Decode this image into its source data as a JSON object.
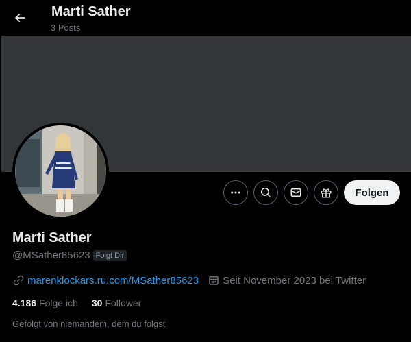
{
  "header": {
    "back_icon": "arrow-left-icon",
    "name": "Marti Sather",
    "posts": "3 Posts"
  },
  "profile": {
    "name": "Marti Sather",
    "handle": "@MSather85623",
    "follows_you_badge": "Folgt Dir",
    "link": "marenklockars.ru.com/MSather85623",
    "joined": "Seit November 2023 bei Twitter",
    "following_count": "4.186",
    "following_label": "Folge ich",
    "followers_count": "30",
    "followers_label": "Follower",
    "followed_by": "Gefolgt von niemandem, dem du folgst"
  },
  "actions": {
    "more_icon": "more-icon",
    "search_icon": "search-icon",
    "message_icon": "mail-icon",
    "gift_icon": "gift-icon",
    "follow_label": "Folgen"
  },
  "colors": {
    "background": "#000000",
    "banner": "#333639",
    "link": "#1d9bf0",
    "muted": "#71767b",
    "follow_button": "#eff3f4"
  }
}
